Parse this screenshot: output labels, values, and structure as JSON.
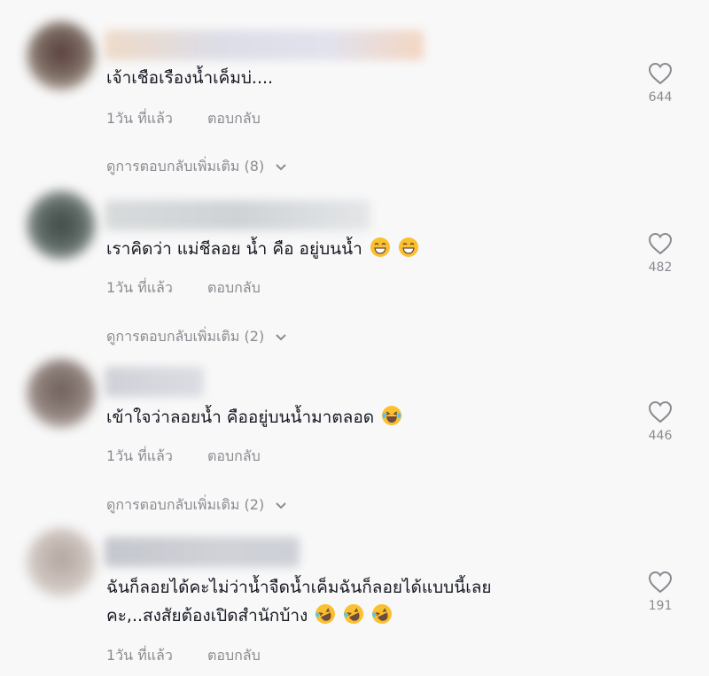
{
  "comments": [
    {
      "text": "เจ้าเชือเรืองน้ำเค็มบ่....",
      "emojis": [],
      "time": "1วัน ที่แล้ว",
      "reply": "ตอบกลับ",
      "likes": "644",
      "more_replies": "ดูการตอบกลับเพิ่มเติม (8)",
      "avatar_color": "#6b5a55",
      "username_color": "#e9d2c2"
    },
    {
      "text": "เราคิดว่า แม่ชีลอย น้ำ คือ อยู่บนน้ำ",
      "emojis": [
        "grin-emoji",
        "grin-emoji"
      ],
      "time": "1วัน ที่แล้ว",
      "reply": "ตอบกลับ",
      "likes": "482",
      "more_replies": "ดูการตอบกลับเพิ่มเติม (2)",
      "avatar_color": "#4d5a55",
      "username_color": "#d5d8da"
    },
    {
      "text": "เข้าใจว่าลอยน้ำ คืออยู่บนน้ำมาตลอด",
      "emojis": [
        "laughing-tears-emoji"
      ],
      "time": "1วัน ที่แล้ว",
      "reply": "ตอบกลับ",
      "likes": "446",
      "more_replies": "ดูการตอบกลับเพิ่มเติม (2)",
      "avatar_color": "#8a7a75",
      "username_color": "#d6d7dc"
    },
    {
      "text_line1": "ฉันก็ลอยได้คะไม่ว่าน้ำจืดน้ำเค็มฉันก็ลอยได้แบบนี้เลย",
      "text_line2": "คะ,..สงสัยต้องเปิดสำนักบ้าง",
      "emojis": [
        "rofl-emoji",
        "rofl-emoji",
        "rofl-emoji"
      ],
      "time": "1วัน ที่แล้ว",
      "reply": "ตอบกลับ",
      "likes": "191",
      "avatar_color": "#c9bdb6",
      "username_color": "#c7c9d0"
    }
  ],
  "colors": {
    "background": "#f8f8f8",
    "text": "#161823",
    "muted": "#8a8b91"
  }
}
